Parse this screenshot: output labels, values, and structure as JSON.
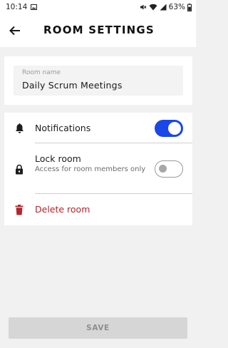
{
  "status_bar": {
    "time": "10:14",
    "battery": "63%",
    "icons": [
      "image-icon",
      "mute-icon",
      "wifi-icon",
      "signal-icon",
      "battery-icon"
    ]
  },
  "header": {
    "title": "ROOM SETTINGS",
    "back_icon": "arrow-left-icon"
  },
  "room_name": {
    "label": "Room name",
    "value": "Daily Scrum Meetings"
  },
  "settings": {
    "notifications": {
      "label": "Notifications",
      "enabled": true,
      "icon": "bell-icon"
    },
    "lock_room": {
      "label": "Lock room",
      "description": "Access for room members only",
      "enabled": false,
      "icon": "lock-icon"
    },
    "delete_room": {
      "label": "Delete room",
      "icon": "trash-icon"
    }
  },
  "footer": {
    "save_label": "SAVE"
  },
  "colors": {
    "accent": "#1a47e8",
    "danger": "#b3262d",
    "background": "#f1f1f1"
  }
}
